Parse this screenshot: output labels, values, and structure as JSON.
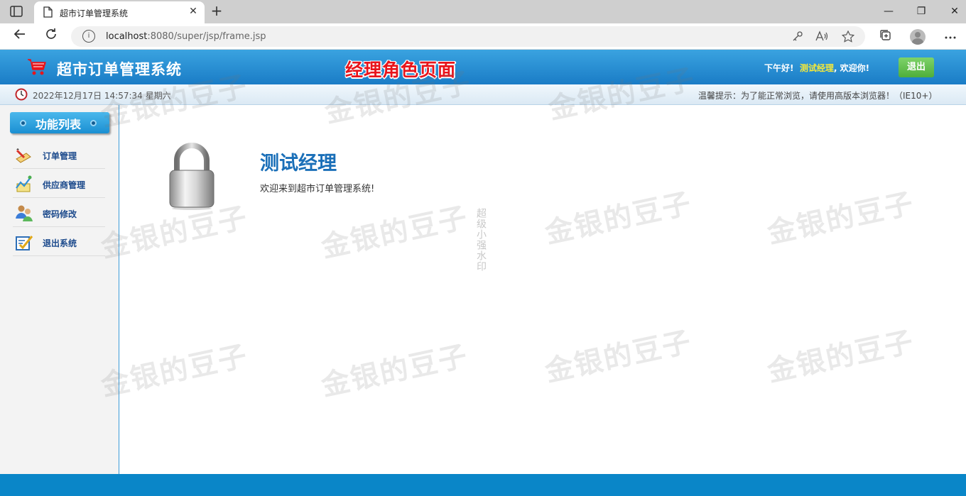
{
  "browser": {
    "tab_title": "超市订单管理系统",
    "tab_close": "✕",
    "new_tab": "+",
    "url_host": "localhost",
    "url_rest": ":8080/super/jsp/frame.jsp",
    "window_min": "—",
    "window_restore": "❐",
    "window_close": "✕"
  },
  "header": {
    "app_title": "超市订单管理系统",
    "role_title": "经理角色页面",
    "greeting_prefix": "下午好!",
    "user_name": "测试经理",
    "greeting_suffix": ", 欢迎你!",
    "logout_label": "退出"
  },
  "status": {
    "datetime": "2022年12月17日 14:57:34 星期六",
    "tip": "温馨提示：为了能正常浏览，请使用高版本浏览器！（IE10+）"
  },
  "sidebar": {
    "title": "功能列表",
    "items": [
      {
        "label": "订单管理"
      },
      {
        "label": "供应商管理"
      },
      {
        "label": "密码修改"
      },
      {
        "label": "退出系统"
      }
    ]
  },
  "main": {
    "user_title": "测试经理",
    "welcome": "欢迎来到超市订单管理系统!",
    "vertical_watermark": "超级小强水印"
  },
  "watermark_text": "金银的豆子",
  "colors": {
    "header_blue": "#1a7cc6",
    "role_red": "#e8141b",
    "logout_green": "#4fae3a",
    "footer_blue": "#0a86c8"
  }
}
